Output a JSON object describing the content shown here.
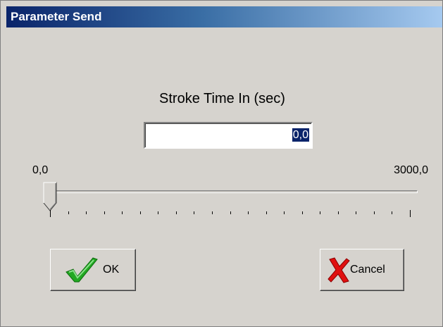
{
  "window": {
    "title": "Parameter Send"
  },
  "field": {
    "label": "Stroke Time In (sec)",
    "value": "0,0"
  },
  "slider": {
    "min_label": "0,0",
    "max_label": "3000,0",
    "value_fraction": 0.0,
    "tick_count": 21
  },
  "buttons": {
    "ok_label": "OK",
    "ok_icon": "checkmark-icon",
    "cancel_label": "Cancel",
    "cancel_icon": "red-x-icon"
  },
  "colors": {
    "titlebar_start": "#0a246a",
    "titlebar_end": "#a6caf0",
    "dialog_bg": "#d6d3ce",
    "check_green": "#22a822",
    "cancel_red": "#e01010"
  }
}
